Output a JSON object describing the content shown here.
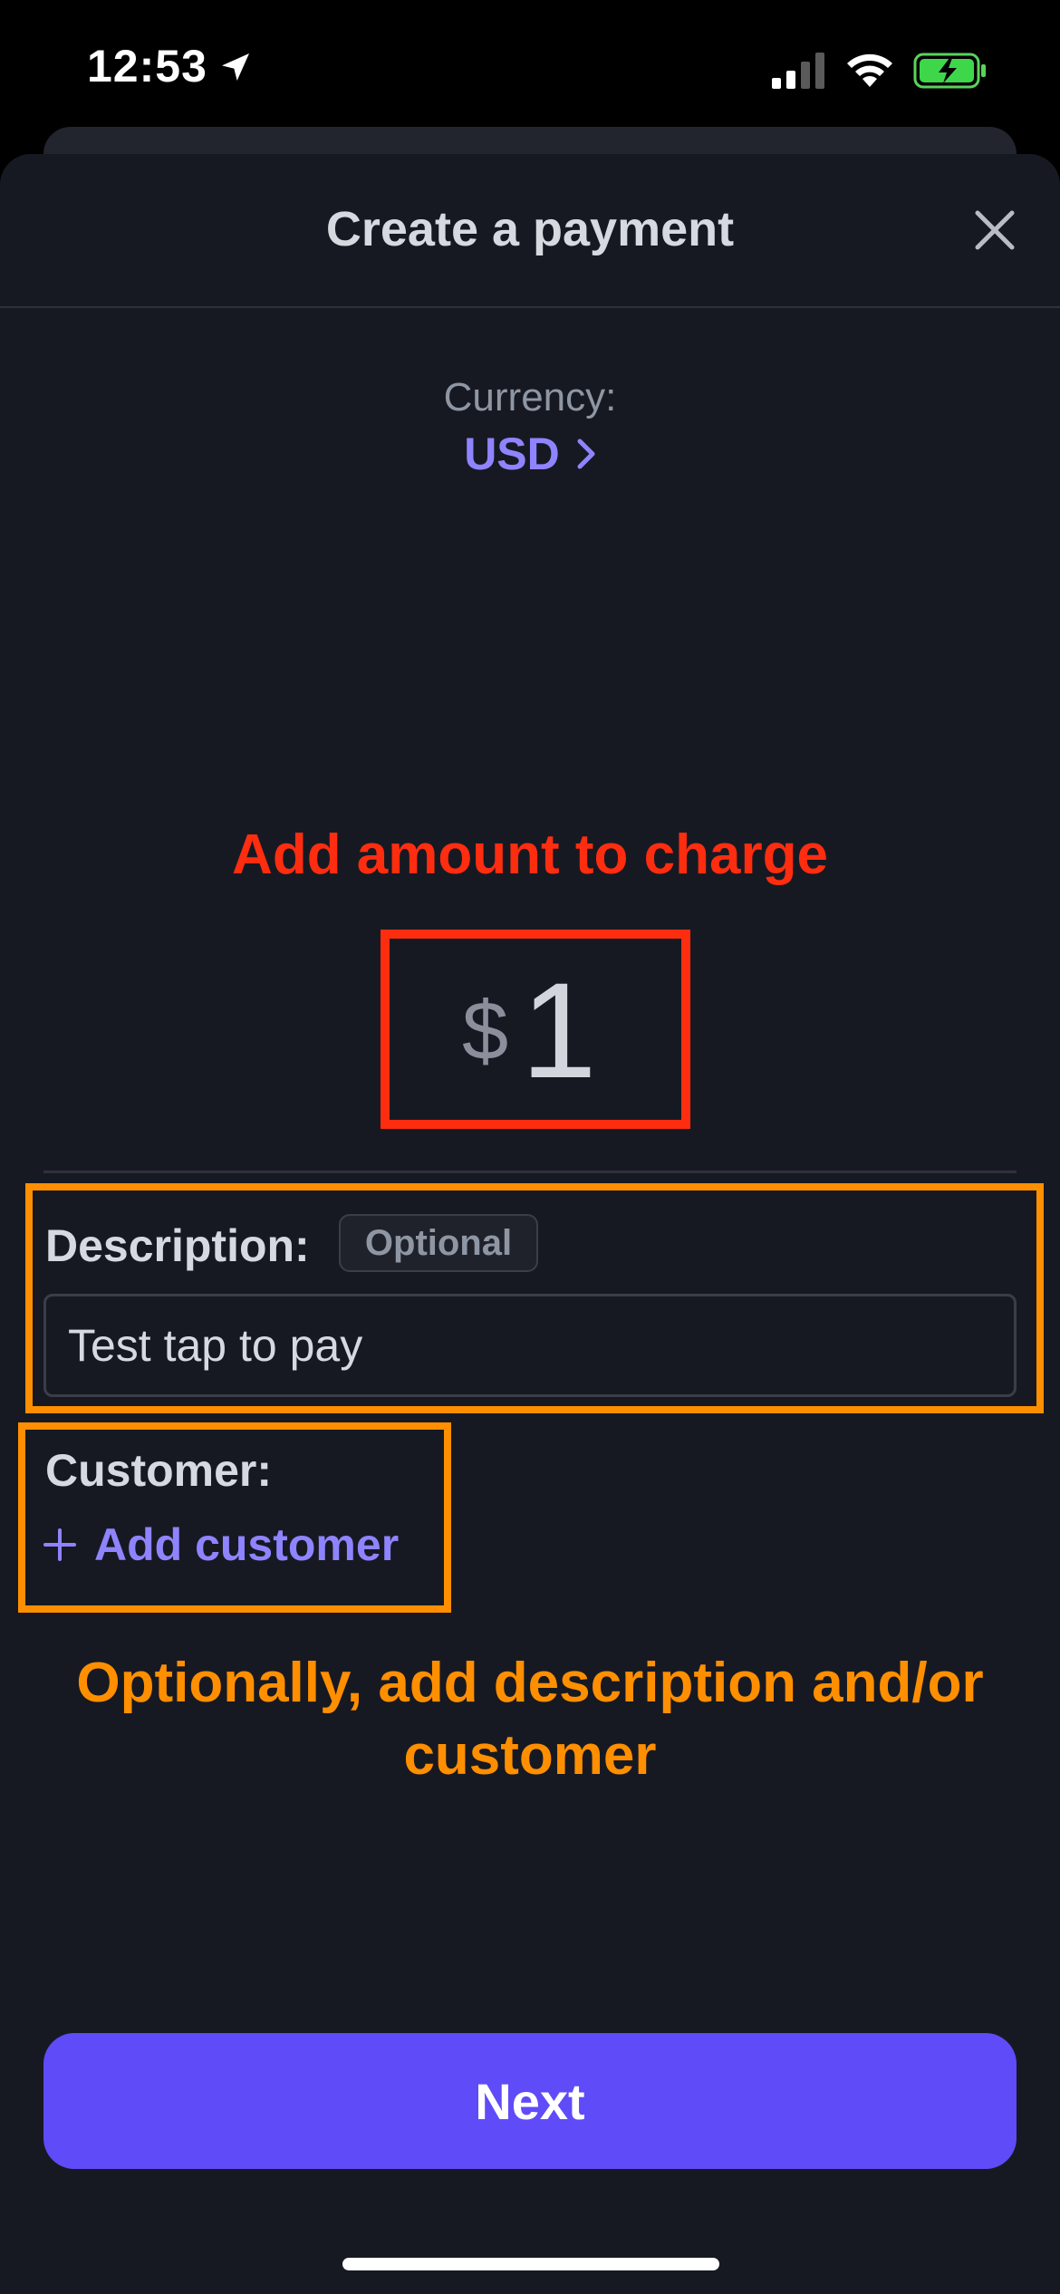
{
  "status_bar": {
    "time": "12:53",
    "icons": [
      "location-arrow-icon",
      "cellular-signal-icon",
      "wifi-icon",
      "battery-charging-icon"
    ]
  },
  "header": {
    "title": "Create a payment",
    "close_icon": "close-icon"
  },
  "currency": {
    "label": "Currency:",
    "value": "USD"
  },
  "amount": {
    "annotation": "Add amount to charge",
    "symbol": "$",
    "value": "1"
  },
  "description": {
    "label": "Description:",
    "badge": "Optional",
    "value": "Test tap to pay"
  },
  "customer": {
    "label": "Customer:",
    "add_label": "Add customer"
  },
  "annotation_optional": "Optionally, add description and/or customer",
  "next_button": "Next",
  "colors": {
    "accent": "#5f4bf8",
    "link": "#8f84ff",
    "annotation_red": "#ff2d0f",
    "annotation_orange": "#ff8f00",
    "background": "#171922"
  }
}
